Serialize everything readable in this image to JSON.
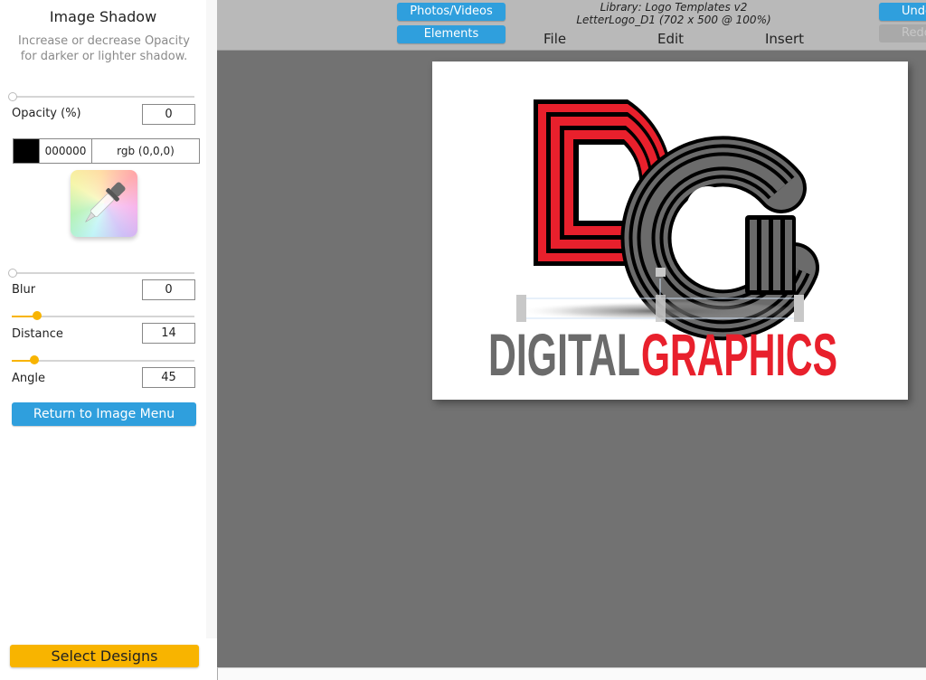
{
  "sidebar": {
    "title": "Image Shadow",
    "description": "Increase or decrease Opacity for darker or lighter shadow.",
    "opacity": {
      "label": "Opacity (%)",
      "value": "0",
      "slider_fraction": 0.0
    },
    "color": {
      "hex": "000000",
      "rgb": "rgb (0,0,0)",
      "swatch": "#000000"
    },
    "color_picker_icon": "eyedropper-icon",
    "blur": {
      "label": "Blur",
      "value": "0",
      "slider_fraction": 0.0
    },
    "distance": {
      "label": "Distance",
      "value": "14",
      "slider_fraction": 0.14
    },
    "angle": {
      "label": "Angle",
      "value": "45",
      "slider_fraction": 0.125
    },
    "return_button": "Return to Image Menu",
    "select_designs_button": "Select Designs"
  },
  "header": {
    "photos_videos_button": "Photos/Videos",
    "elements_button": "Elements",
    "library_line": "Library: Logo Templates v2",
    "document_line": "LetterLogo_D1 (702 x 500 @ 100%)",
    "menu": [
      "File",
      "Edit",
      "Insert"
    ],
    "undo_button": "Undo",
    "redo_button": "Redo"
  },
  "canvas": {
    "logo": {
      "monogram": "DG",
      "word_left": "DIGITAL",
      "word_right": "GRAPHICS",
      "color_red": "#e8202c",
      "color_gray": "#6b6b6b"
    }
  },
  "colors": {
    "accent_blue": "#2f9fdd",
    "accent_orange": "#f8b400",
    "canvas_bg": "#727272",
    "header_bg": "#b9b9b9"
  }
}
